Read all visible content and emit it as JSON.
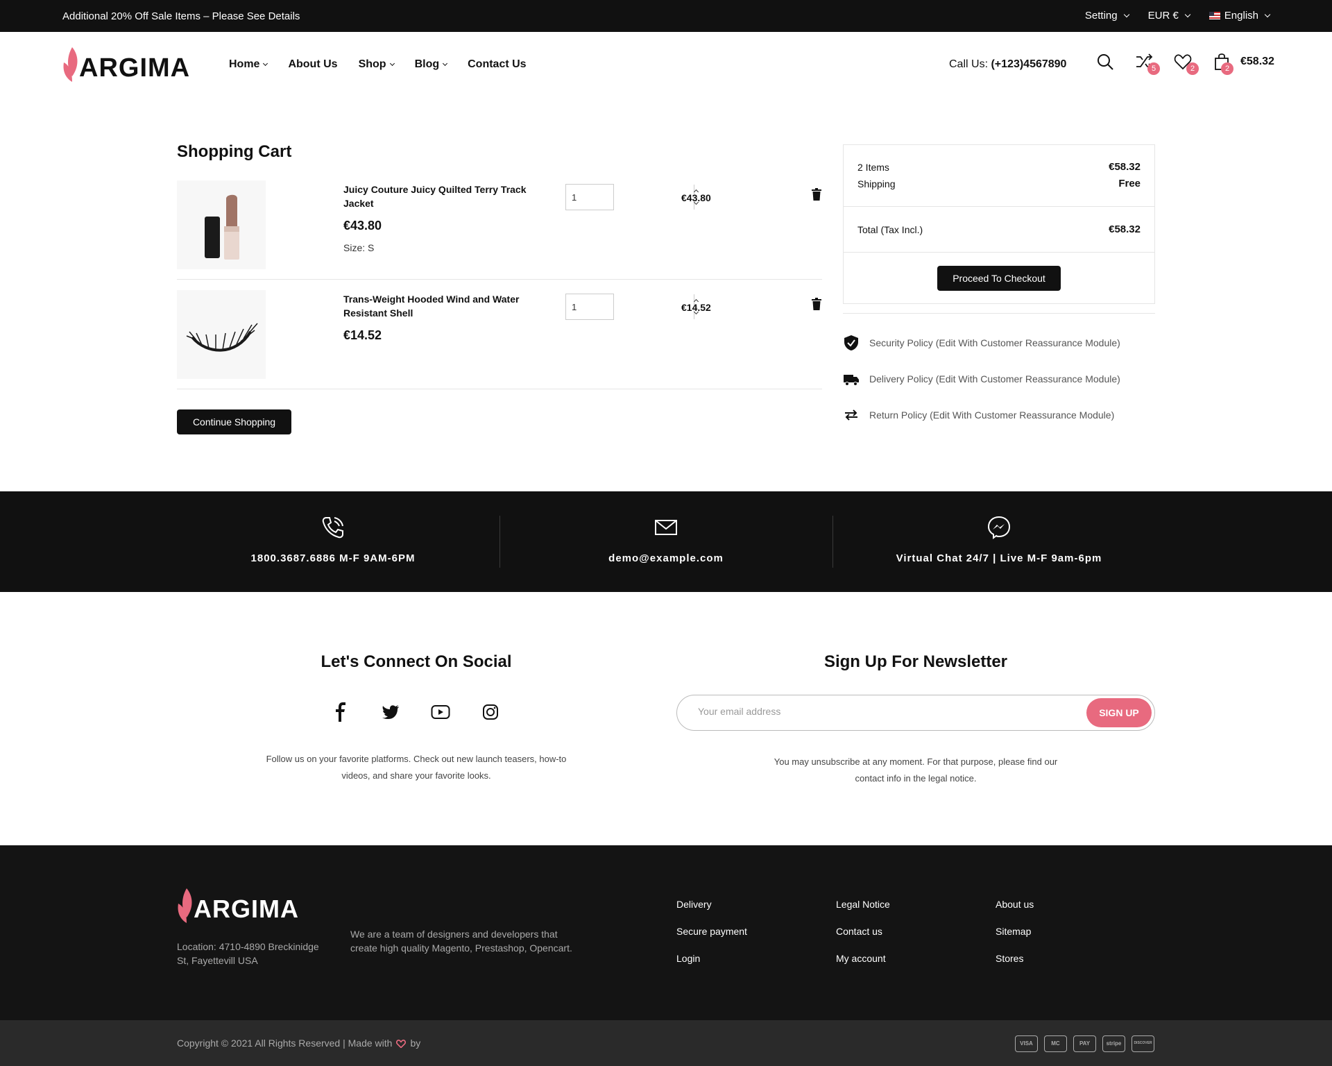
{
  "topbar": {
    "promo": "Additional 20% Off Sale Items – Please See Details",
    "setting": "Setting",
    "currency": "EUR €",
    "language": "English"
  },
  "header": {
    "logo": "ARGIMA",
    "nav": [
      "Home",
      "About Us",
      "Shop",
      "Blog",
      "Contact Us"
    ],
    "call_label": "Call Us:",
    "call_number": "(+123)4567890",
    "compare_count": "5",
    "wishlist_count": "2",
    "cart_count": "2",
    "cart_total": "€58.32"
  },
  "cart": {
    "title": "Shopping Cart",
    "items": [
      {
        "name": "Juicy Couture Juicy Quilted Terry Track Jacket",
        "price": "€43.80",
        "size": "Size: S",
        "qty": "1",
        "total": "€43.80",
        "image": "lipstick"
      },
      {
        "name": "Trans-Weight Hooded Wind and Water Resistant Shell",
        "price": "€14.52",
        "qty": "1",
        "total": "€14.52",
        "image": "eyelashes"
      }
    ],
    "continue_label": "Continue Shopping"
  },
  "summary": {
    "items_label": "2 Items",
    "items_value": "€58.32",
    "shipping_label": "Shipping",
    "shipping_value": "Free",
    "total_label": "Total (Tax Incl.)",
    "total_value": "€58.32",
    "checkout_label": "Proceed To Checkout"
  },
  "reassurance": [
    "Security Policy (Edit With Customer Reassurance Module)",
    "Delivery Policy (Edit With Customer Reassurance Module)",
    "Return Policy (Edit With Customer Reassurance Module)"
  ],
  "contact_strip": {
    "phone": "1800.3687.6886 M-F 9AM-6PM",
    "email": "demo@example.com",
    "chat": "Virtual Chat 24/7 | Live M-F 9am-6pm"
  },
  "social": {
    "title": "Let's Connect On Social",
    "icons": [
      "facebook-icon",
      "twitter-icon",
      "youtube-icon",
      "instagram-icon"
    ],
    "desc": "Follow us on your favorite platforms. Check out new launch teasers, how-to videos, and share your favorite looks."
  },
  "newsletter": {
    "title": "Sign Up For Newsletter",
    "placeholder": "Your email address",
    "button": "SIGN UP",
    "desc": "You may unsubscribe at any moment. For that purpose, please find our contact info in the legal notice."
  },
  "footer": {
    "logo": "ARGIMA",
    "location": "Location: 4710-4890 Breckinidge St, Fayettevill USA",
    "about": "We are a team of designers and developers that create high quality Magento, Prestashop, Opencart.",
    "col1": [
      "Delivery",
      "Secure payment",
      "Login"
    ],
    "col2": [
      "Legal Notice",
      "Contact us",
      "My account"
    ],
    "col3": [
      "About us",
      "Sitemap",
      "Stores"
    ],
    "copyright": "Copyright © 2021 All Rights Reserved | Made with",
    "by": "by",
    "payments": [
      "VISA",
      "MC",
      "PAY",
      "stripe",
      "DISCOVER"
    ]
  },
  "colors": {
    "accent": "#e86a7f",
    "dark": "#111111"
  }
}
